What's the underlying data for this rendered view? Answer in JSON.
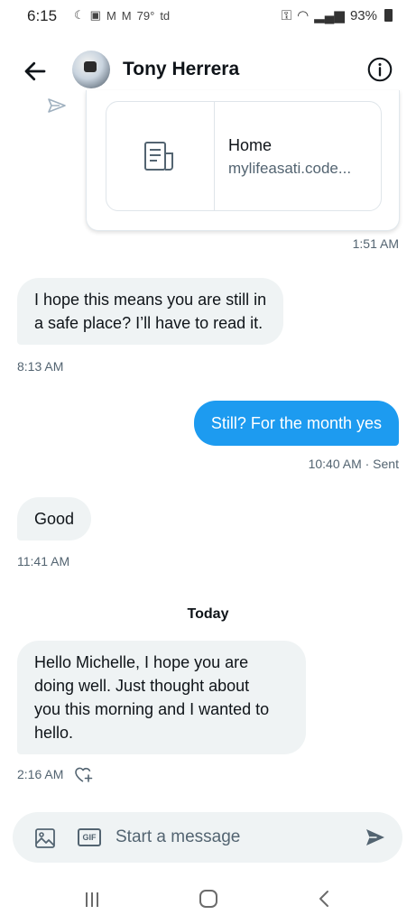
{
  "status_bar": {
    "time": "6:15",
    "temperature": "79°",
    "carrier_text": "td",
    "battery": "93%"
  },
  "header": {
    "contact_name": "Tony Herrera"
  },
  "link_card": {
    "title": "Home",
    "domain": "mylifeasati.code..."
  },
  "messages": [
    {
      "direction": "outgoing",
      "timestamp": "1:51 AM"
    },
    {
      "direction": "incoming",
      "lines": [
        "I hope this means you are still in",
        "a safe place?  I’ll have to read it."
      ],
      "timestamp": "8:13 AM"
    },
    {
      "direction": "outgoing",
      "text": "Still? For the month yes",
      "timestamp": "10:40 AM · Sent"
    },
    {
      "direction": "incoming",
      "text": "Good",
      "timestamp": "11:41 AM"
    },
    {
      "direction": "incoming",
      "lines": [
        "Hello Michelle, I hope you are",
        "doing well. Just thought about",
        "you this morning and I wanted to",
        "hello."
      ],
      "timestamp": "2:16 AM"
    }
  ],
  "day_separator": "Today",
  "composer": {
    "placeholder": "Start a message",
    "gif_label": "GIF"
  },
  "colors": {
    "accent": "#1d9bf0",
    "incoming_bubble": "#eff3f4",
    "secondary_text": "#536471"
  },
  "icons": [
    "back-arrow-icon",
    "info-icon",
    "share-arrow-icon",
    "document-icon",
    "image-icon",
    "gif-icon",
    "send-icon",
    "heart-plus-icon",
    "recents-icon",
    "home-icon",
    "nav-back-icon"
  ]
}
